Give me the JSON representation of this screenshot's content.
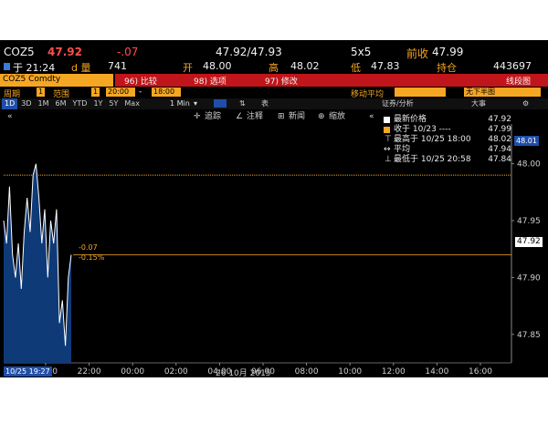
{
  "header": {
    "ticker": "COZ5",
    "last": "47.92",
    "change": "-.07",
    "bid_ask": "47.92/47.93",
    "size": "5x5",
    "prev_close_label": "前收",
    "prev_close": "47.99",
    "time_label": "于 21:24",
    "volume_label": "d 量",
    "volume": "741",
    "open_label": "开",
    "open": "48.00",
    "high_label": "高",
    "high": "48.02",
    "low_label": "低",
    "low": "47.83",
    "oi_label": "持仓",
    "oi": "443697"
  },
  "toolbar1": {
    "security": "COZ5 Comdty",
    "compare": "96) 比较",
    "options": "98) 选项",
    "modify": "97) 修改",
    "linechart": "线段图"
  },
  "toolbar2": {
    "period_label": "周期",
    "period_value": "1",
    "range_label": "范围",
    "range_value": "1",
    "time_from": "20:00",
    "time_to": "18:00",
    "ma_label": "移动平均",
    "ma_value": "无下半图"
  },
  "ranges": [
    "1D",
    "3D",
    "1M",
    "6M",
    "YTD",
    "1Y",
    "5Y",
    "Max"
  ],
  "interval": "1 Min",
  "toolbar_right": {
    "securities": "证券/分析",
    "large": "大事"
  },
  "chart_tools": {
    "track": "追踪",
    "annotate": "注释",
    "news": "新闻",
    "zoom": "缩放"
  },
  "legend": [
    {
      "label": "最新价格",
      "value": "47.92",
      "color": "#ffffff"
    },
    {
      "label": "收于 10/23 ----",
      "value": "47.99",
      "color": "#f5a623"
    },
    {
      "label": "最高于 10/25 18:00",
      "value": "48.02",
      "color": ""
    },
    {
      "label": "平均",
      "value": "47.94",
      "color": ""
    },
    {
      "label": "最低于 10/25 20:58",
      "value": "47.84",
      "color": ""
    }
  ],
  "annotations": {
    "change_abs": "-0.07",
    "change_pct": "-0.15%",
    "high_tag": "48.01",
    "last_tag": "47.92",
    "time_tag": "10/25 19:27"
  },
  "xaxis_date": "26 10月 2015",
  "chart_data": {
    "type": "area",
    "x_ticks": [
      "20:00",
      "22:00",
      "00:00",
      "02:00",
      "04:00",
      "06:00",
      "08:00",
      "10:00",
      "12:00",
      "14:00",
      "16:00"
    ],
    "y_ticks": [
      "48.00",
      "47.95",
      "47.90",
      "47.85"
    ],
    "ylim": [
      47.825,
      48.035
    ],
    "reference_line": 47.99,
    "last_price": 47.92,
    "series": [
      {
        "values": [
          47.95,
          47.93,
          47.98,
          47.92,
          47.9,
          47.93,
          47.89,
          47.94,
          47.97,
          47.94,
          47.99,
          48.0,
          47.97,
          47.93,
          47.96,
          47.9,
          47.95,
          47.93,
          47.96,
          47.86,
          47.88,
          47.84,
          47.9,
          47.92
        ]
      }
    ],
    "grid": false
  }
}
